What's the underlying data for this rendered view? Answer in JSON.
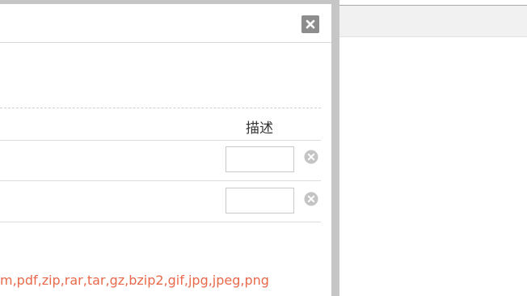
{
  "table": {
    "headers": {
      "description": "描述"
    },
    "rows": [
      {
        "description_value": ""
      },
      {
        "description_value": ""
      }
    ]
  },
  "upload": {
    "allowed_types": "m,pdf,zip,rar,tar,gz,bzip2,gif,jpg,jpeg,png"
  },
  "colors": {
    "accent_text": "#e9694a",
    "close_button_bg": "#8d8d8d",
    "remove_icon": "#c4c4c4"
  },
  "icons": {
    "close": "close-icon",
    "remove": "remove-circle-icon"
  }
}
